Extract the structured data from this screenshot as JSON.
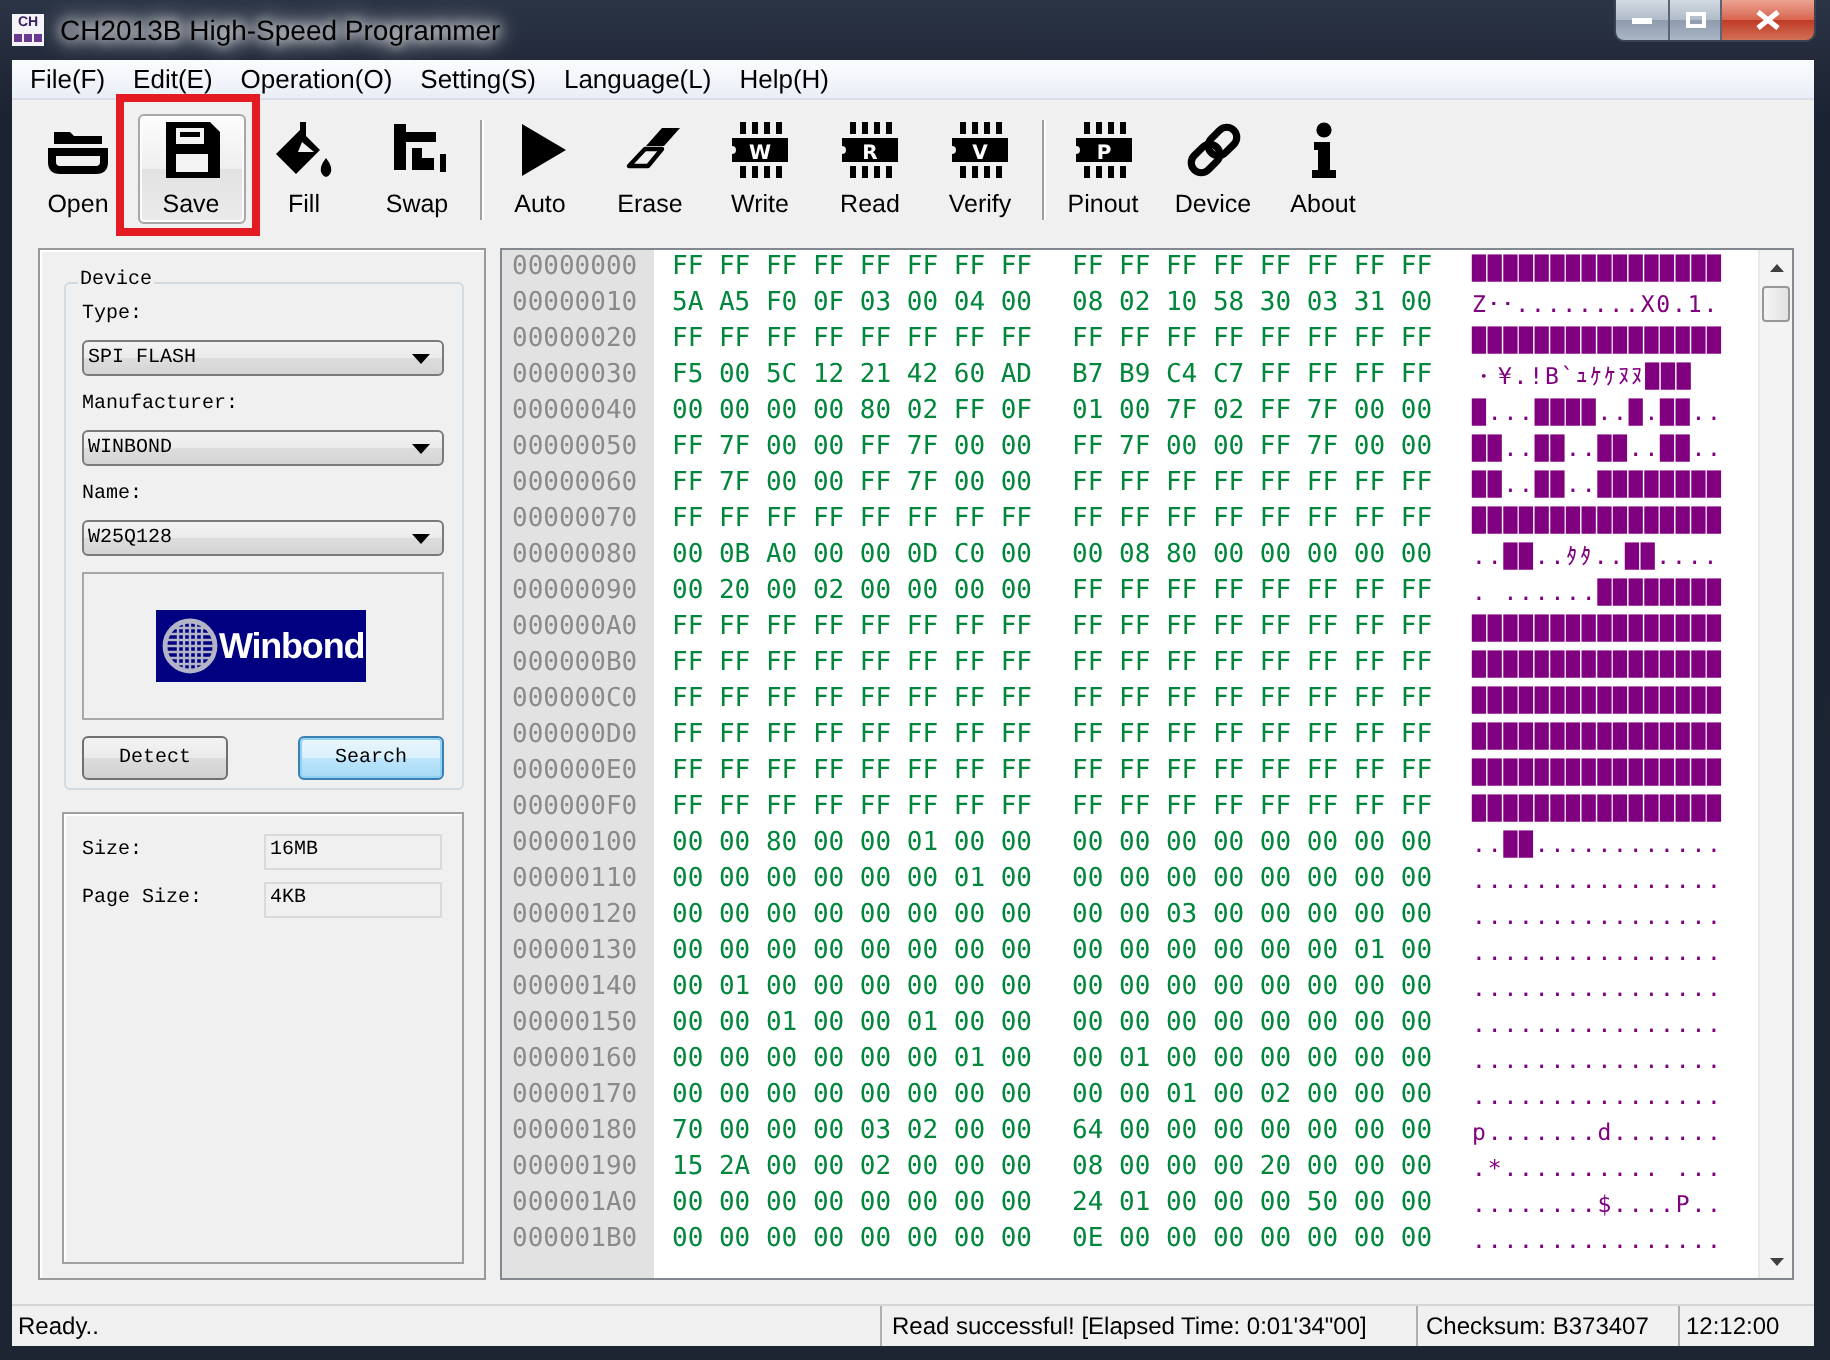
{
  "window": {
    "title": "CH2013B High-Speed Programmer",
    "icon_label": "CH"
  },
  "menu": [
    "File(F)",
    "Edit(E)",
    "Operation(O)",
    "Setting(S)",
    "Language(L)",
    "Help(H)"
  ],
  "toolbar": {
    "groups": [
      [
        {
          "label": "Open",
          "hovered": false,
          "highlighted": false
        },
        {
          "label": "Save",
          "hovered": true,
          "highlighted": true
        },
        {
          "label": "Fill",
          "hovered": false,
          "highlighted": false
        },
        {
          "label": "Swap",
          "hovered": false,
          "highlighted": false
        }
      ],
      [
        {
          "label": "Auto",
          "hovered": false,
          "highlighted": false
        },
        {
          "label": "Erase",
          "hovered": false,
          "highlighted": false
        },
        {
          "label": "Write",
          "chip_letter": "W",
          "hovered": false,
          "highlighted": false
        },
        {
          "label": "Read",
          "chip_letter": "R",
          "hovered": false,
          "highlighted": false
        },
        {
          "label": "Verify",
          "chip_letter": "V",
          "hovered": false,
          "highlighted": false
        }
      ],
      [
        {
          "label": "Pinout",
          "chip_letter": "P",
          "hovered": false,
          "highlighted": false
        },
        {
          "label": "Device",
          "hovered": false,
          "highlighted": false
        },
        {
          "label": "About",
          "hovered": false,
          "highlighted": false
        }
      ]
    ]
  },
  "device_panel": {
    "title": "Device",
    "fields": [
      {
        "label": "Type:",
        "value": "SPI FLASH"
      },
      {
        "label": "Manufacturer:",
        "value": "WINBOND"
      },
      {
        "label": "Name:",
        "value": "W25Q128"
      }
    ],
    "logo": {
      "text": "Winbond"
    },
    "buttons": [
      {
        "label": "Detect",
        "focused": false
      },
      {
        "label": "Search",
        "focused": true
      }
    ]
  },
  "info_panel": {
    "fields": [
      {
        "label": "Size:",
        "value": "16MB"
      },
      {
        "label": "Page Size:",
        "value": "4KB"
      }
    ]
  },
  "hex_view": {
    "rows": [
      {
        "address": "00000000",
        "bytes": [
          "FF FF FF FF FF FF FF FF",
          "FF FF FF FF FF FF FF FF"
        ],
        "ascii": "████████████████"
      },
      {
        "address": "00000010",
        "bytes": [
          "5A A5 F0 0F 03 00 04 00",
          "08 02 10 58 30 03 31 00"
        ],
        "ascii": "Z･･........X0.1."
      },
      {
        "address": "00000020",
        "bytes": [
          "FF FF FF FF FF FF FF FF",
          "FF FF FF FF FF FF FF FF"
        ],
        "ascii": "████████████████"
      },
      {
        "address": "00000030",
        "bytes": [
          "F5 00 5C 12 21 42 60 AD",
          "B7 B9 C4 C7 FF FF FF FF"
        ],
        "ascii": "・¥.!B`ｭｹｹﾇﾇ███"
      },
      {
        "address": "00000040",
        "bytes": [
          "00 00 00 00 80 02 FF 0F",
          "01 00 7F 02 FF 7F 00 00"
        ],
        "ascii": "█...████..█.██.."
      },
      {
        "address": "00000050",
        "bytes": [
          "FF 7F 00 00 FF 7F 00 00",
          "FF 7F 00 00 FF 7F 00 00"
        ],
        "ascii": "██..██..██..██.."
      },
      {
        "address": "00000060",
        "bytes": [
          "FF 7F 00 00 FF 7F 00 00",
          "FF FF FF FF FF FF FF FF"
        ],
        "ascii": "██..██..████████"
      },
      {
        "address": "00000070",
        "bytes": [
          "FF FF FF FF FF FF FF FF",
          "FF FF FF FF FF FF FF FF"
        ],
        "ascii": "████████████████"
      },
      {
        "address": "00000080",
        "bytes": [
          "00 0B A0 00 00 0D C0 00",
          "00 08 80 00 00 00 00 00"
        ],
        "ascii": "..██..ﾀﾀ..██...."
      },
      {
        "address": "00000090",
        "bytes": [
          "00 20 00 02 00 00 00 00",
          "FF FF FF FF FF FF FF FF"
        ],
        "ascii": ". ......████████"
      },
      {
        "address": "000000A0",
        "bytes": [
          "FF FF FF FF FF FF FF FF",
          "FF FF FF FF FF FF FF FF"
        ],
        "ascii": "████████████████"
      },
      {
        "address": "000000B0",
        "bytes": [
          "FF FF FF FF FF FF FF FF",
          "FF FF FF FF FF FF FF FF"
        ],
        "ascii": "████████████████"
      },
      {
        "address": "000000C0",
        "bytes": [
          "FF FF FF FF FF FF FF FF",
          "FF FF FF FF FF FF FF FF"
        ],
        "ascii": "████████████████"
      },
      {
        "address": "000000D0",
        "bytes": [
          "FF FF FF FF FF FF FF FF",
          "FF FF FF FF FF FF FF FF"
        ],
        "ascii": "████████████████"
      },
      {
        "address": "000000E0",
        "bytes": [
          "FF FF FF FF FF FF FF FF",
          "FF FF FF FF FF FF FF FF"
        ],
        "ascii": "████████████████"
      },
      {
        "address": "000000F0",
        "bytes": [
          "FF FF FF FF FF FF FF FF",
          "FF FF FF FF FF FF FF FF"
        ],
        "ascii": "████████████████"
      },
      {
        "address": "00000100",
        "bytes": [
          "00 00 80 00 00 01 00 00",
          "00 00 00 00 00 00 00 00"
        ],
        "ascii": "..██............"
      },
      {
        "address": "00000110",
        "bytes": [
          "00 00 00 00 00 00 01 00",
          "00 00 00 00 00 00 00 00"
        ],
        "ascii": "................"
      },
      {
        "address": "00000120",
        "bytes": [
          "00 00 00 00 00 00 00 00",
          "00 00 03 00 00 00 00 00"
        ],
        "ascii": "................"
      },
      {
        "address": "00000130",
        "bytes": [
          "00 00 00 00 00 00 00 00",
          "00 00 00 00 00 00 01 00"
        ],
        "ascii": "................"
      },
      {
        "address": "00000140",
        "bytes": [
          "00 01 00 00 00 00 00 00",
          "00 00 00 00 00 00 00 00"
        ],
        "ascii": "................"
      },
      {
        "address": "00000150",
        "bytes": [
          "00 00 01 00 00 01 00 00",
          "00 00 00 00 00 00 00 00"
        ],
        "ascii": "................"
      },
      {
        "address": "00000160",
        "bytes": [
          "00 00 00 00 00 00 01 00",
          "00 01 00 00 00 00 00 00"
        ],
        "ascii": "................"
      },
      {
        "address": "00000170",
        "bytes": [
          "00 00 00 00 00 00 00 00",
          "00 00 01 00 02 00 00 00"
        ],
        "ascii": "................"
      },
      {
        "address": "00000180",
        "bytes": [
          "70 00 00 00 03 02 00 00",
          "64 00 00 00 00 00 00 00"
        ],
        "ascii": "p.......d......."
      },
      {
        "address": "00000190",
        "bytes": [
          "15 2A 00 00 02 00 00 00",
          "08 00 00 00 20 00 00 00"
        ],
        "ascii": ".*.......... ..."
      },
      {
        "address": "000001A0",
        "bytes": [
          "00 00 00 00 00 00 00 00",
          "24 01 00 00 00 50 00 00"
        ],
        "ascii": "........$....P.."
      },
      {
        "address": "000001B0",
        "bytes": [
          "00 00 00 00 00 00 00 00",
          "0E 00 00 00 00 00 00 00"
        ],
        "ascii": "................"
      }
    ]
  },
  "status_bar": {
    "state": "Ready..",
    "result": "Read successful! [Elapsed Time: 0:01'34\"00]",
    "checksum": "Checksum: B373407",
    "time": "12:12:00"
  }
}
